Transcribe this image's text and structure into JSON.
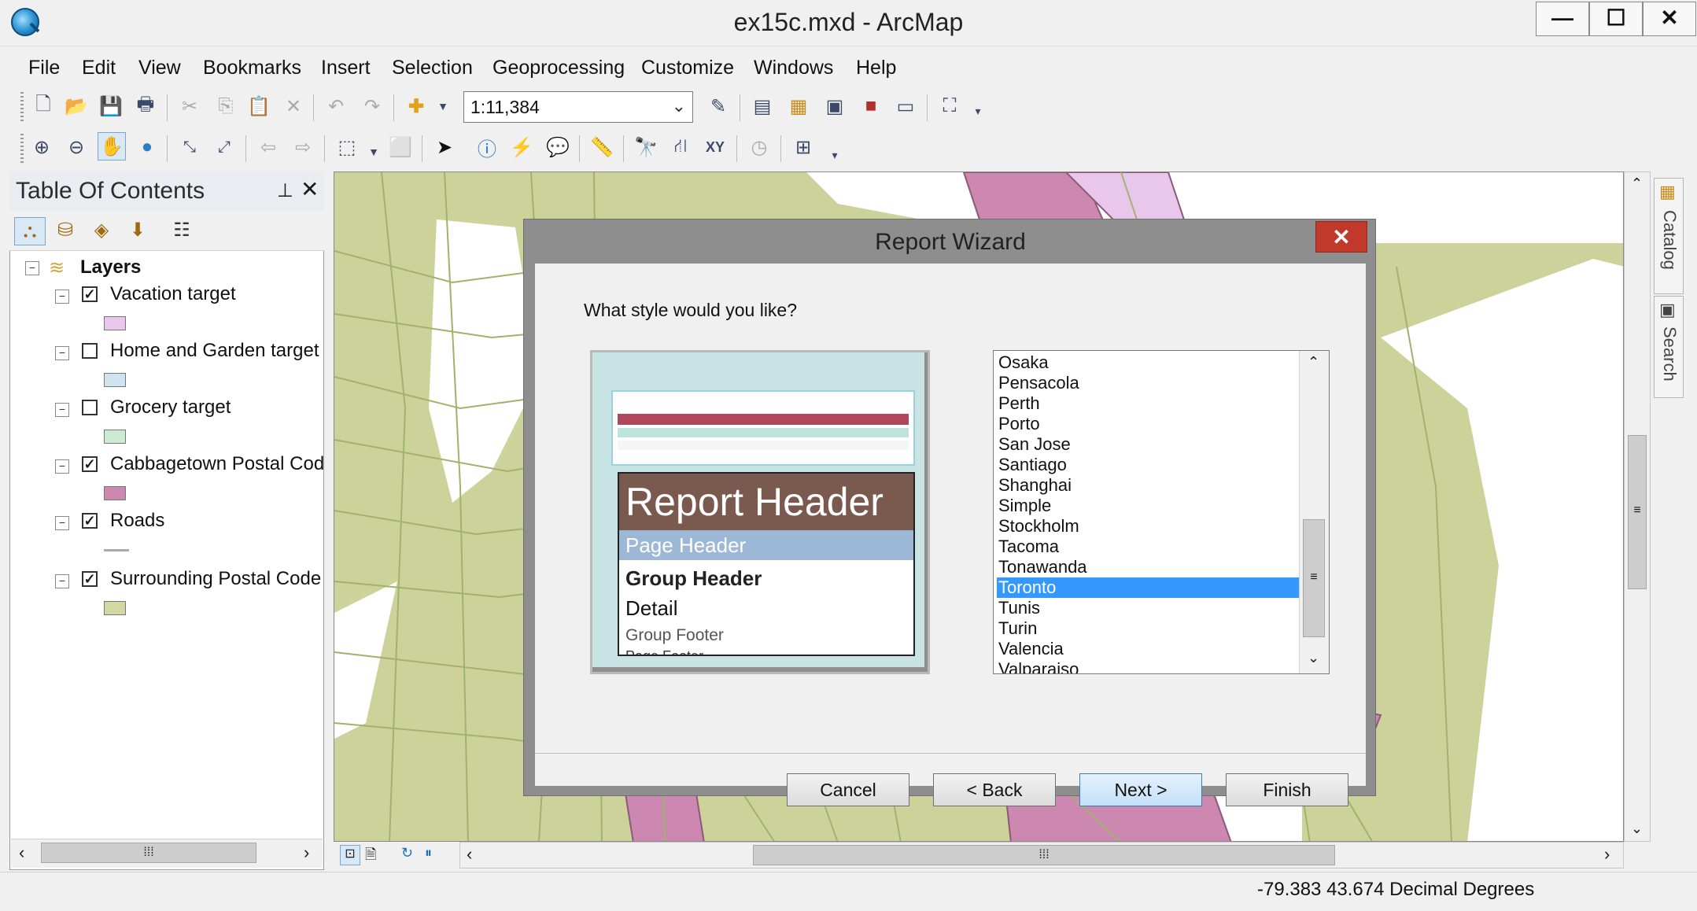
{
  "window": {
    "title": "ex15c.mxd - ArcMap",
    "controls": {
      "minimize": "—",
      "maximize": "☐",
      "close": "✕"
    }
  },
  "menu": [
    "File",
    "Edit",
    "View",
    "Bookmarks",
    "Insert",
    "Selection",
    "Geoprocessing",
    "Customize",
    "Windows",
    "Help"
  ],
  "toolbar": {
    "scale": "1:11,384",
    "standard_icons": [
      "new-document-icon",
      "open-folder-icon",
      "save-icon",
      "print-icon",
      "cut-icon",
      "copy-icon",
      "paste-icon",
      "delete-icon",
      "undo-icon",
      "redo-icon",
      "add-data-icon"
    ],
    "tools_icons": [
      "zoom-in-icon",
      "zoom-out-icon",
      "pan-icon",
      "full-extent-icon",
      "fixed-zoom-in-icon",
      "fixed-zoom-out-icon",
      "back-extent-icon",
      "forward-extent-icon",
      "select-features-icon",
      "clear-selection-icon",
      "select-elements-icon",
      "identify-icon",
      "hyperlink-icon",
      "html-popup-icon",
      "measure-icon",
      "find-icon",
      "find-route-icon",
      "go-to-xy-icon",
      "time-slider-icon",
      "viewer-window-icon"
    ]
  },
  "toc": {
    "title": "Table Of Contents",
    "root_label": "Layers",
    "layers": [
      {
        "name": "Vacation target",
        "checked": true,
        "swatch": "#e9c6ec"
      },
      {
        "name": "Home and Garden target",
        "checked": false,
        "swatch": "#cfe3f0"
      },
      {
        "name": "Grocery target",
        "checked": false,
        "swatch": "#cdebd0"
      },
      {
        "name": "Cabbagetown Postal Cod",
        "checked": true,
        "swatch": "#cc88b0"
      },
      {
        "name": "Roads",
        "checked": true,
        "swatch": "line"
      },
      {
        "name": "Surrounding Postal Code",
        "checked": true,
        "swatch": "#d2d8a0"
      }
    ]
  },
  "side_tabs": [
    "Catalog",
    "Search"
  ],
  "status": {
    "coordinates": "-79.383  43.674 Decimal Degrees"
  },
  "dialog": {
    "title": "Report Wizard",
    "question": "What style would you like?",
    "preview": {
      "report_header": "Report Header",
      "page_header": "Page Header",
      "group_header": "Group Header",
      "detail": "Detail",
      "group_footer": "Group Footer",
      "page_footer": "Page Footer"
    },
    "styles": [
      "Osaka",
      "Pensacola",
      "Perth",
      "Porto",
      "San Jose",
      "Santiago",
      "Shanghai",
      "Simple",
      "Stockholm",
      "Tacoma",
      "Tonawanda",
      "Toronto",
      "Tunis",
      "Turin",
      "Valencia",
      "Valparaiso"
    ],
    "selected_style": "Toronto",
    "buttons": {
      "cancel": "Cancel",
      "back": "< Back",
      "next": "Next >",
      "finish": "Finish"
    }
  },
  "colors": {
    "map_base": "#cdd29b",
    "map_lines": "#9fb46a",
    "target_pink": "#cc88b0",
    "selection": "#3399ff"
  }
}
